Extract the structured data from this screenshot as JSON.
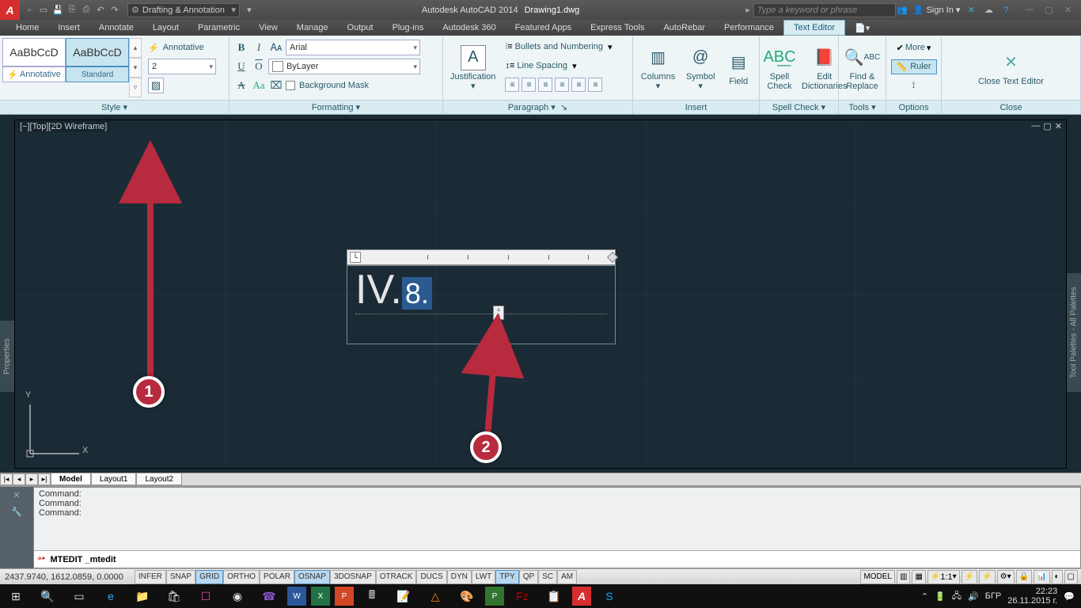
{
  "titlebar": {
    "workspace": "Drafting & Annotation",
    "app": "Autodesk AutoCAD 2014",
    "doc": "Drawing1.dwg",
    "search_placeholder": "Type a keyword or phrase",
    "signin": "Sign In"
  },
  "menus": [
    "Home",
    "Insert",
    "Annotate",
    "Layout",
    "Parametric",
    "View",
    "Manage",
    "Output",
    "Plug-ins",
    "Autodesk 360",
    "Featured Apps",
    "Express Tools",
    "AutoRebar",
    "Performance",
    "Text Editor"
  ],
  "active_menu": "Text Editor",
  "ribbon": {
    "style": {
      "sample": "AaBbCcD",
      "label_annotative": "Annotative",
      "label_standard": "Standard",
      "panel_title": "Style",
      "opt_annotative": "Annotative",
      "height": "2"
    },
    "format": {
      "font": "Arial",
      "layer": "ByLayer",
      "bg_mask": "Background Mask",
      "panel_title": "Formatting"
    },
    "paragraph": {
      "justification": "Justification",
      "bullets": "Bullets and Numbering",
      "spacing": "Line Spacing",
      "panel_title": "Paragraph"
    },
    "insert": {
      "columns": "Columns",
      "symbol": "Symbol",
      "field": "Field",
      "panel_title": "Insert"
    },
    "spell": {
      "check": "Spell\nCheck",
      "dict": "Edit\nDictionaries",
      "panel_title": "Spell Check"
    },
    "tools": {
      "find": "Find &\nReplace",
      "panel_title": "Tools"
    },
    "options": {
      "more": "More",
      "ruler": "Ruler",
      "panel_title": "Options"
    },
    "close": {
      "close": "Close Text Editor",
      "panel_title": "Close"
    }
  },
  "viewport": {
    "label": "[−][Top][2D Wireframe]"
  },
  "mtext": {
    "big": "IV.",
    "sel": "8."
  },
  "callouts": {
    "c1": "1",
    "c2": "2"
  },
  "layout_tabs": [
    "Model",
    "Layout1",
    "Layout2"
  ],
  "command": {
    "hist": [
      "Command:",
      "Command:",
      "Command:"
    ],
    "line": "MTEDIT _mtedit"
  },
  "status": {
    "coords": "2437.9740, 1612.0859, 0.0000",
    "toggles": [
      "INFER",
      "SNAP",
      "GRID",
      "ORTHO",
      "POLAR",
      "OSNAP",
      "3DOSNAP",
      "OTRACK",
      "DUCS",
      "DYN",
      "LWT",
      "TPY",
      "QP",
      "SC",
      "AM"
    ],
    "on": [
      "GRID",
      "OSNAP",
      "TPY"
    ],
    "model": "MODEL",
    "scale": "1:1"
  },
  "tray": {
    "lang": "БГР",
    "time": "22:23",
    "date": "26.11.2015 г."
  },
  "sidebar": {
    "props": "Properties",
    "tools": "Tool Palettes - All Palettes"
  }
}
